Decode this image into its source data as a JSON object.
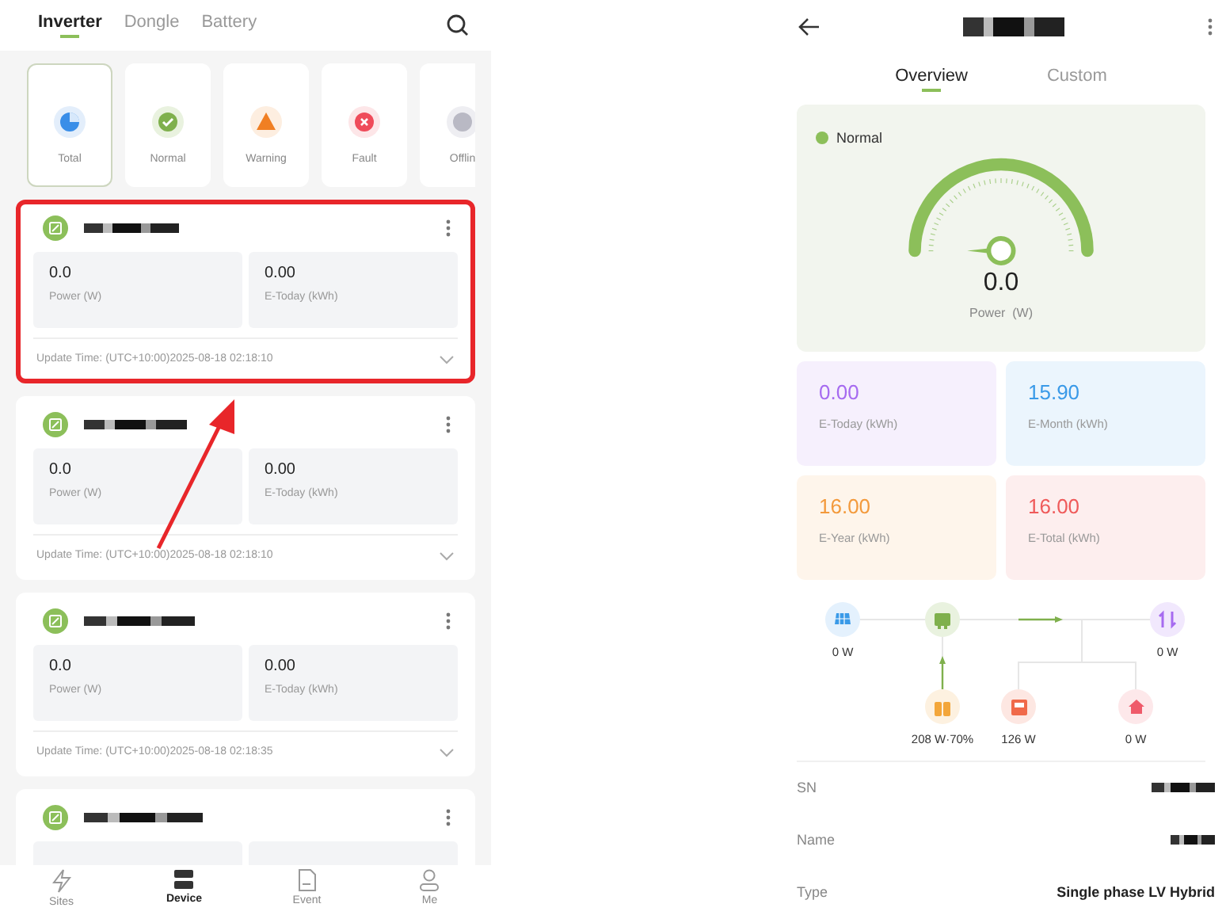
{
  "device_list": {
    "tabs": [
      {
        "label": "Inverter",
        "selected": true
      },
      {
        "label": "Dongle",
        "selected": false
      },
      {
        "label": "Battery",
        "selected": false
      }
    ],
    "filters": [
      {
        "kind": "total",
        "label": "Total",
        "selected": true
      },
      {
        "kind": "normal",
        "label": "Normal",
        "selected": false
      },
      {
        "kind": "warning",
        "label": "Warning",
        "selected": false
      },
      {
        "kind": "fault",
        "label": "Fault",
        "selected": false
      },
      {
        "kind": "offline",
        "label": "Offlin",
        "selected": false
      }
    ],
    "devices": [
      {
        "kind": "full",
        "highlighted": true,
        "power": "0.0",
        "power_label": "Power (W)",
        "today": "0.00",
        "today_label": "E-Today (kWh)",
        "update": "Update Time: (UTC+10:00)2025-08-18 02:18:10"
      },
      {
        "kind": "full",
        "highlighted": false,
        "power": "0.0",
        "power_label": "Power (W)",
        "today": "0.00",
        "today_label": "E-Today (kWh)",
        "update": "Update Time: (UTC+10:00)2025-08-18 02:18:10"
      },
      {
        "kind": "full",
        "highlighted": false,
        "power": "0.0",
        "power_label": "Power (W)",
        "today": "0.00",
        "today_label": "E-Today (kWh)",
        "update": "Update Time: (UTC+10:00)2025-08-18 02:18:35"
      },
      {
        "kind": "partial",
        "highlighted": false
      }
    ],
    "nav": [
      {
        "kind": "sites",
        "label": "Sites",
        "selected": false
      },
      {
        "kind": "device",
        "label": "Device",
        "selected": true
      },
      {
        "kind": "event",
        "label": "Event",
        "selected": false
      },
      {
        "kind": "me",
        "label": "Me",
        "selected": false
      }
    ]
  },
  "device_detail": {
    "tabs": [
      {
        "label": "Overview",
        "selected": true
      },
      {
        "label": "Custom",
        "selected": false
      }
    ],
    "status": {
      "label": "Normal",
      "color": "#8cbf5a"
    },
    "gauge": {
      "value": "0.0",
      "label": "Power  (W)"
    },
    "stats": [
      {
        "value": "0.00",
        "label": "E-Today (kWh)",
        "color": "#a66bf0"
      },
      {
        "value": "15.90",
        "label": "E-Month (kWh)",
        "color": "#3a9ae8"
      },
      {
        "value": "16.00",
        "label": "E-Year (kWh)",
        "color": "#f39a3c"
      },
      {
        "value": "16.00",
        "label": "E-Total (kWh)",
        "color": "#ef5a5a"
      }
    ],
    "flow": [
      {
        "kind": "solar",
        "reading": "0 W"
      },
      {
        "kind": "inverter"
      },
      {
        "kind": "grid",
        "reading": "0 W"
      },
      {
        "kind": "battery",
        "reading": "208 W·70%"
      },
      {
        "kind": "load",
        "reading": "126 W"
      },
      {
        "kind": "home",
        "reading": "0 W"
      }
    ],
    "info": [
      {
        "kind": "redacted",
        "label": "SN"
      },
      {
        "kind": "redacted",
        "label": "Name"
      },
      {
        "kind": "text",
        "label": "Type",
        "value": "Single phase LV Hybrid"
      }
    ]
  }
}
